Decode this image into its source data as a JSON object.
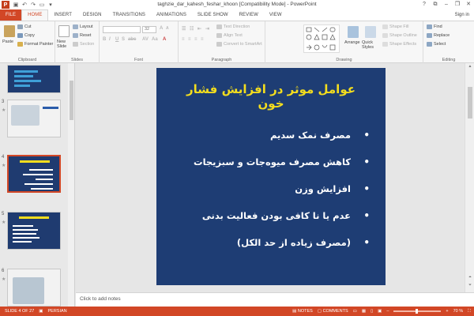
{
  "window": {
    "title": "taghzie_dar_kahesh_feshar_khoon [Compatibility Mode] - PowerPoint",
    "app_icon_letter": "P",
    "sign_in": "Sign in"
  },
  "tabs": [
    "FILE",
    "HOME",
    "INSERT",
    "DESIGN",
    "TRANSITIONS",
    "ANIMATIONS",
    "SLIDE SHOW",
    "REVIEW",
    "VIEW"
  ],
  "active_tab": "HOME",
  "ribbon": {
    "clipboard": {
      "label": "Clipboard",
      "paste": "Paste",
      "cut": "Cut",
      "copy": "Copy",
      "format_painter": "Format Painter"
    },
    "slides": {
      "label": "Slides",
      "new_slide": "New Slide",
      "layout": "Layout",
      "reset": "Reset",
      "section": "Section"
    },
    "font": {
      "label": "Font",
      "size": "32"
    },
    "paragraph": {
      "label": "Paragraph",
      "text_direction": "Text Direction",
      "align_text": "Align Text",
      "convert_smartart": "Convert to SmartArt"
    },
    "drawing": {
      "label": "Drawing",
      "arrange": "Arrange",
      "quick_styles": "Quick Styles",
      "shape_fill": "Shape Fill",
      "shape_outline": "Shape Outline",
      "shape_effects": "Shape Effects"
    },
    "editing": {
      "label": "Editing",
      "find": "Find",
      "replace": "Replace",
      "select": "Select"
    }
  },
  "thumbnails": [
    {
      "num": "",
      "star": ""
    },
    {
      "num": "3",
      "star": "★"
    },
    {
      "num": "4",
      "star": "★"
    },
    {
      "num": "5",
      "star": "★"
    },
    {
      "num": "6",
      "star": "★"
    }
  ],
  "slide": {
    "title": "عوامل موثر در افزایش فشار خون",
    "bullets": [
      "مصرف نمک سدیم",
      "کاهش مصرف میوه‌جات و سبزیجات",
      "افزایش وزن",
      "عدم یا نا کافی بودن فعالیت بدنی",
      "(مصرف زیاده از حد الکل)"
    ],
    "bg_color": "#1e3d74",
    "title_color": "#f3dd1e"
  },
  "notes_placeholder": "Click to add notes",
  "status": {
    "slide_info": "SLIDE 4 OF 27",
    "language": "PERSIAN",
    "notes": "NOTES",
    "comments": "COMMENTS",
    "zoom": "70 %"
  },
  "colors": {
    "accent": "#d24726"
  }
}
